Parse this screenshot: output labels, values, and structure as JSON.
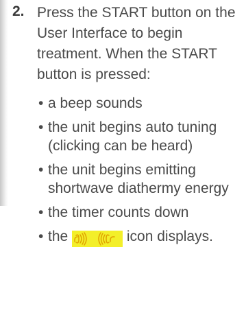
{
  "step": {
    "number": "2.",
    "text": "Press the START button on the User Interface to begin treatment. When the START button is pressed:"
  },
  "bullets": [
    {
      "prefix": "",
      "text": "a beep sounds"
    },
    {
      "prefix": "",
      "text": "the unit begins auto tuning (clicking can be heard)"
    },
    {
      "prefix": "",
      "text": "the unit begins emitting shortwave diathermy energy"
    },
    {
      "prefix": "",
      "text": "the timer counts down"
    },
    {
      "prefix": "the ",
      "text": " icon displays."
    }
  ],
  "bullet_symbol": "•",
  "icon": {
    "name": "emission-waves-icon",
    "highlight_color": "#f3ef2a",
    "icon_color": "#e0a300"
  }
}
